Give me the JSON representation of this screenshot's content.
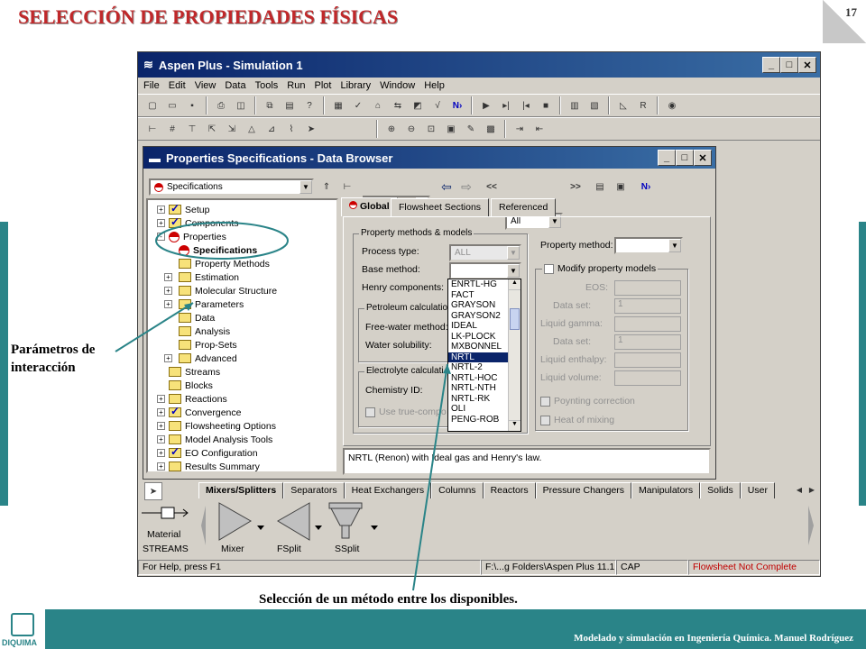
{
  "slide": {
    "title": "SELECCIÓN DE PROPIEDADES FÍSICAS",
    "page_number": "17",
    "footer": "Modelado y simulación en Ingeniería Química.  Manuel Rodríguez",
    "logo_text": "DIQUIMA",
    "annotation_left": "Parámetros de interacción",
    "caption": "Selección de un método entre los disponibles.",
    "accent_color": "#2a8488",
    "title_color": "#c0282a"
  },
  "app": {
    "title": "Aspen Plus - Simulation 1",
    "menu": [
      "File",
      "Edit",
      "View",
      "Data",
      "Tools",
      "Run",
      "Plot",
      "Library",
      "Window",
      "Help"
    ]
  },
  "data_browser": {
    "title": "Properties Specifications - Data Browser",
    "nav_combo": "Specifications",
    "filter_combo": "All",
    "tree": [
      {
        "label": "Setup",
        "indent": 1,
        "icon": "chk",
        "exp": "+"
      },
      {
        "label": "Components",
        "indent": 1,
        "icon": "chk",
        "exp": "+"
      },
      {
        "label": "Properties",
        "indent": 1,
        "icon": "red",
        "exp": "-"
      },
      {
        "label": "Specifications",
        "indent": 2,
        "icon": "red",
        "exp": "",
        "bold": true
      },
      {
        "label": "Property Methods",
        "indent": 2,
        "icon": "folder",
        "exp": ""
      },
      {
        "label": "Estimation",
        "indent": 2,
        "icon": "folder",
        "exp": "+"
      },
      {
        "label": "Molecular Structure",
        "indent": 2,
        "icon": "folder",
        "exp": "+"
      },
      {
        "label": "Parameters",
        "indent": 2,
        "icon": "folder",
        "exp": "+"
      },
      {
        "label": "Data",
        "indent": 2,
        "icon": "folder",
        "exp": ""
      },
      {
        "label": "Analysis",
        "indent": 2,
        "icon": "folder",
        "exp": ""
      },
      {
        "label": "Prop-Sets",
        "indent": 2,
        "icon": "folder",
        "exp": ""
      },
      {
        "label": "Advanced",
        "indent": 2,
        "icon": "folder",
        "exp": "+"
      },
      {
        "label": "Streams",
        "indent": 1,
        "icon": "folder",
        "exp": ""
      },
      {
        "label": "Blocks",
        "indent": 1,
        "icon": "folder",
        "exp": ""
      },
      {
        "label": "Reactions",
        "indent": 1,
        "icon": "folder",
        "exp": "+"
      },
      {
        "label": "Convergence",
        "indent": 1,
        "icon": "chk",
        "exp": "+"
      },
      {
        "label": "Flowsheeting Options",
        "indent": 1,
        "icon": "folder",
        "exp": "+"
      },
      {
        "label": "Model Analysis Tools",
        "indent": 1,
        "icon": "folder",
        "exp": "+"
      },
      {
        "label": "EO Configuration",
        "indent": 1,
        "icon": "chk",
        "exp": "+"
      },
      {
        "label": "Results Summary",
        "indent": 1,
        "icon": "folder",
        "exp": "+"
      }
    ],
    "tabs": [
      "Global",
      "Flowsheet Sections",
      "Referenced"
    ],
    "group_methods": "Property methods & models",
    "process_type_label": "Process type:",
    "process_type_value": "ALL",
    "base_method_label": "Base method:",
    "henry_label": "Henry components:",
    "petroleum_group": "Petroleum calculatio",
    "free_water_label": "Free-water method:",
    "water_solubility_label": "Water solubility:",
    "electrolyte_group": "Electrolyte calculati",
    "chemistry_label": "Chemistry ID:",
    "true_comp_label": "Use true-compo",
    "property_method_label": "Property method:",
    "modify_label": "Modify property models",
    "eos_label": "EOS:",
    "dataset_label": "Data set:",
    "dataset_value": "1",
    "liquid_gamma_label": "Liquid gamma:",
    "dataset2_label": "Data set:",
    "dataset2_value": "1",
    "liquid_enthalpy_label": "Liquid enthalpy:",
    "liquid_volume_label": "Liquid volume:",
    "poynting_label": "Poynting correction",
    "heat_mixing_label": "Heat of mixing",
    "dropdown": [
      "ENRTL-HG",
      "FACT",
      "GRAYSON",
      "GRAYSON2",
      "IDEAL",
      "LK-PLOCK",
      "MXBONNEL",
      "NRTL",
      "NRTL-2",
      "NRTL-HOC",
      "NRTL-NTH",
      "NRTL-RK",
      "OLI",
      "PENG-ROB"
    ],
    "dropdown_selected": "NRTL",
    "description": "NRTL (Renon) with Ideal gas and Henry's law."
  },
  "palette": {
    "tabs": [
      "Mixers/Splitters",
      "Separators",
      "Heat Exchangers",
      "Columns",
      "Reactors",
      "Pressure Changers",
      "Manipulators",
      "Solids",
      "User"
    ],
    "material_label": "Material",
    "streams_label": "STREAMS",
    "blocks": [
      "Mixer",
      "FSplit",
      "SSplit"
    ]
  },
  "status": {
    "help": "For Help, press F1",
    "path": "F:\\...g Folders\\Aspen Plus 11.1",
    "cap": "CAP",
    "state": "Flowsheet Not Complete"
  }
}
